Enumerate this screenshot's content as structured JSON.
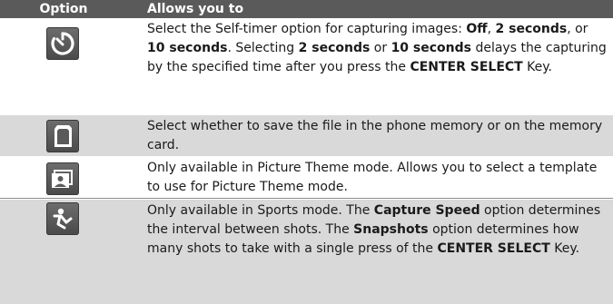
{
  "header": {
    "col1": "Option",
    "col2": "Allows you to"
  },
  "rows": [
    {
      "icon": "self-timer-icon",
      "segments": [
        {
          "t": "Select the Self-timer option for capturing images: ",
          "b": false
        },
        {
          "t": "Off",
          "b": true
        },
        {
          "t": ", ",
          "b": false
        },
        {
          "t": "2 seconds",
          "b": true
        },
        {
          "t": ", or ",
          "b": false
        },
        {
          "t": "10 seconds",
          "b": true
        },
        {
          "t": ". Selecting ",
          "b": false
        },
        {
          "t": "2 seconds",
          "b": true
        },
        {
          "t": " or ",
          "b": false
        },
        {
          "t": "10 seconds",
          "b": true
        },
        {
          "t": " delays the capturing by the specified time after you press the ",
          "b": false
        },
        {
          "t": "CENTER SELECT",
          "b": true
        },
        {
          "t": " Key.",
          "b": false
        }
      ]
    },
    {
      "icon": "storage-memory-card-icon",
      "segments": [
        {
          "t": "Select whether to save the file in the phone memory or on the memory card.",
          "b": false
        }
      ]
    },
    {
      "icon": "picture-theme-template-icon",
      "segments": [
        {
          "t": "Only available in Picture Theme mode. Allows you to select a template to use for Picture Theme mode.",
          "b": false
        }
      ]
    },
    {
      "icon": "sports-capture-speed-icon",
      "segments": [
        {
          "t": "Only available in Sports mode. The ",
          "b": false
        },
        {
          "t": "Capture Speed",
          "b": true
        },
        {
          "t": " option determines the interval between shots. The ",
          "b": false
        },
        {
          "t": "Snapshots",
          "b": true
        },
        {
          "t": " option determines how many shots to take with a single press of the ",
          "b": false
        },
        {
          "t": "CENTER SELECT",
          "b": true
        },
        {
          "t": " Key.",
          "b": false
        }
      ]
    }
  ]
}
